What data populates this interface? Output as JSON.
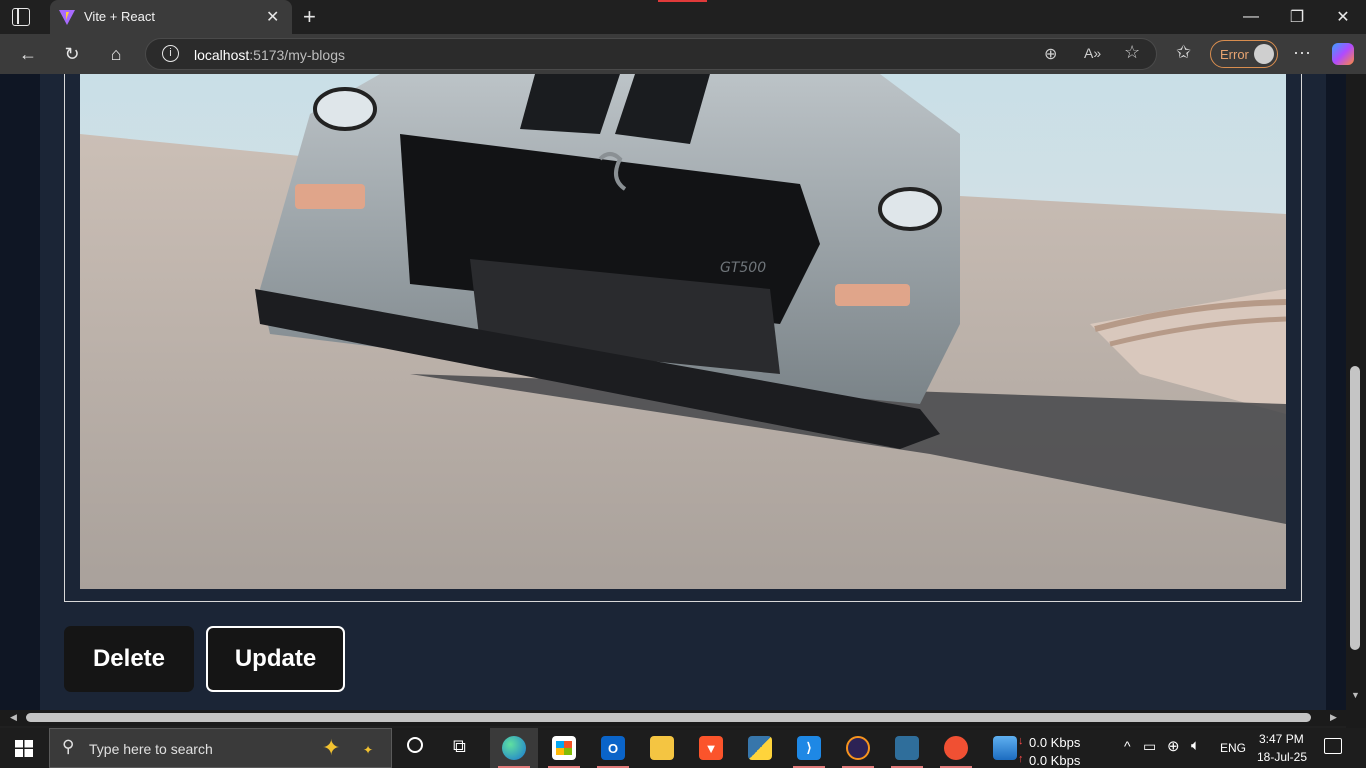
{
  "browser": {
    "tab_title": "Vite + React",
    "url_host": "localhost",
    "url_path": ":5173/my-blogs",
    "profile_status": "Error"
  },
  "page": {
    "delete_label": "Delete",
    "update_label": "Update",
    "image_subject": "silver sports car on desert track"
  },
  "taskbar": {
    "search_placeholder": "Type here to search",
    "net_down": "0.0 Kbps",
    "net_up": "0.0 Kbps",
    "language": "ENG",
    "time": "3:47 PM",
    "date": "18-Jul-25"
  },
  "icons": {
    "tab_actions": "tab-actions-icon",
    "back": "back-arrow-icon",
    "refresh": "refresh-icon",
    "home": "home-icon",
    "info": "info-icon",
    "zoom": "zoom-icon",
    "read_aloud": "read-aloud-icon",
    "favorite": "star-icon"
  },
  "colors": {
    "page_bg": "#1b2536",
    "page_edge": "#0f1624",
    "button_bg": "#151515",
    "error_accent": "#e8a471"
  }
}
